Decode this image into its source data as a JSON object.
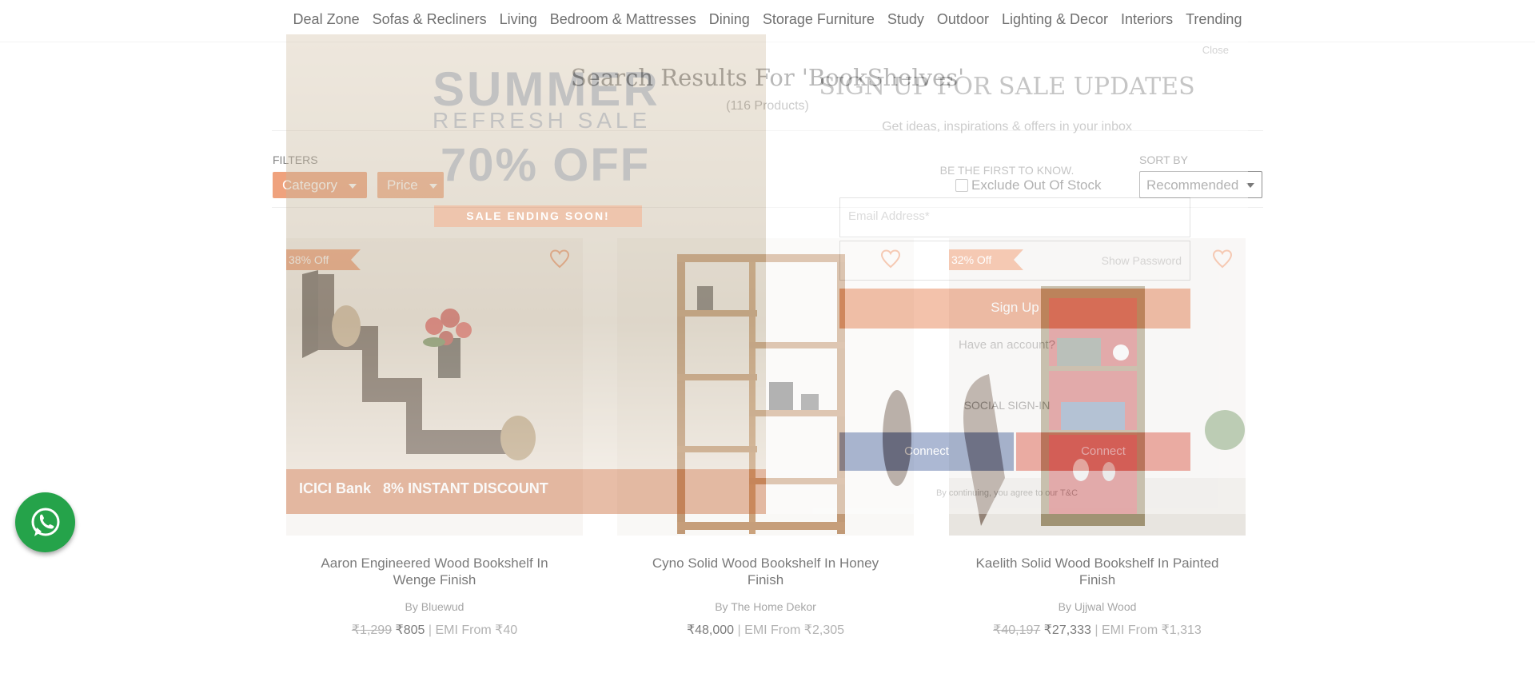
{
  "nav": {
    "items": [
      "Deal Zone",
      "Sofas & Recliners",
      "Living",
      "Bedroom & Mattresses",
      "Dining",
      "Storage Furniture",
      "Study",
      "Outdoor",
      "Lighting & Decor",
      "Interiors",
      "Trending"
    ]
  },
  "search": {
    "title": "Search Results For 'BookShelves'",
    "count": "(116 Products)"
  },
  "filters": {
    "label": "FILTERS",
    "category": "Category",
    "price": "Price",
    "exclude_oos": "Exclude Out Of Stock"
  },
  "sort": {
    "label": "SORT BY",
    "selected": "Recommended"
  },
  "products": [
    {
      "badge": "38% Off",
      "name": "Aaron Engineered Wood Bookshelf In Wenge Finish",
      "brand_prefix": "By",
      "brand": "Bluewud",
      "mrp": "₹1,299",
      "price": "₹805",
      "emi": "EMI From ₹40"
    },
    {
      "badge": "",
      "name": "Cyno Solid Wood Bookshelf In Honey Finish",
      "brand_prefix": "By",
      "brand": "The Home Dekor",
      "mrp": "",
      "price": "₹48,000",
      "emi": "EMI From ₹2,305"
    },
    {
      "badge": "32% Off",
      "name": "Kaelith Solid Wood Bookshelf In Painted Finish",
      "brand_prefix": "By",
      "brand": "Ujjwal Wood",
      "mrp": "₹40,197",
      "price": "₹27,333",
      "emi": "EMI From ₹1,313"
    }
  ],
  "modal": {
    "banner_line1": "SUMMER",
    "banner_line2": "REFRESH SALE",
    "banner_line3": "70% OFF",
    "banner_strip": "SALE ENDING SOON!",
    "banner_bank": "ICICI Bank",
    "banner_discount": "8% INSTANT DISCOUNT",
    "close": "Close",
    "title": "SIGN UP FOR SALE UPDATES",
    "subtitle": "Get ideas, inspirations & offers in your inbox",
    "know": "BE THE FIRST TO KNOW.",
    "email_placeholder": "Email Address*",
    "show_password": "Show Password",
    "signup": "Sign Up",
    "have_account": "Have an account?",
    "social": "SOCIAL SIGN-IN",
    "connect_fb": "Connect",
    "connect_google": "Connect",
    "terms": "By continuing, you agree to our T&C"
  },
  "colors": {
    "accent": "#e77138",
    "whatsapp": "#25a34a"
  }
}
